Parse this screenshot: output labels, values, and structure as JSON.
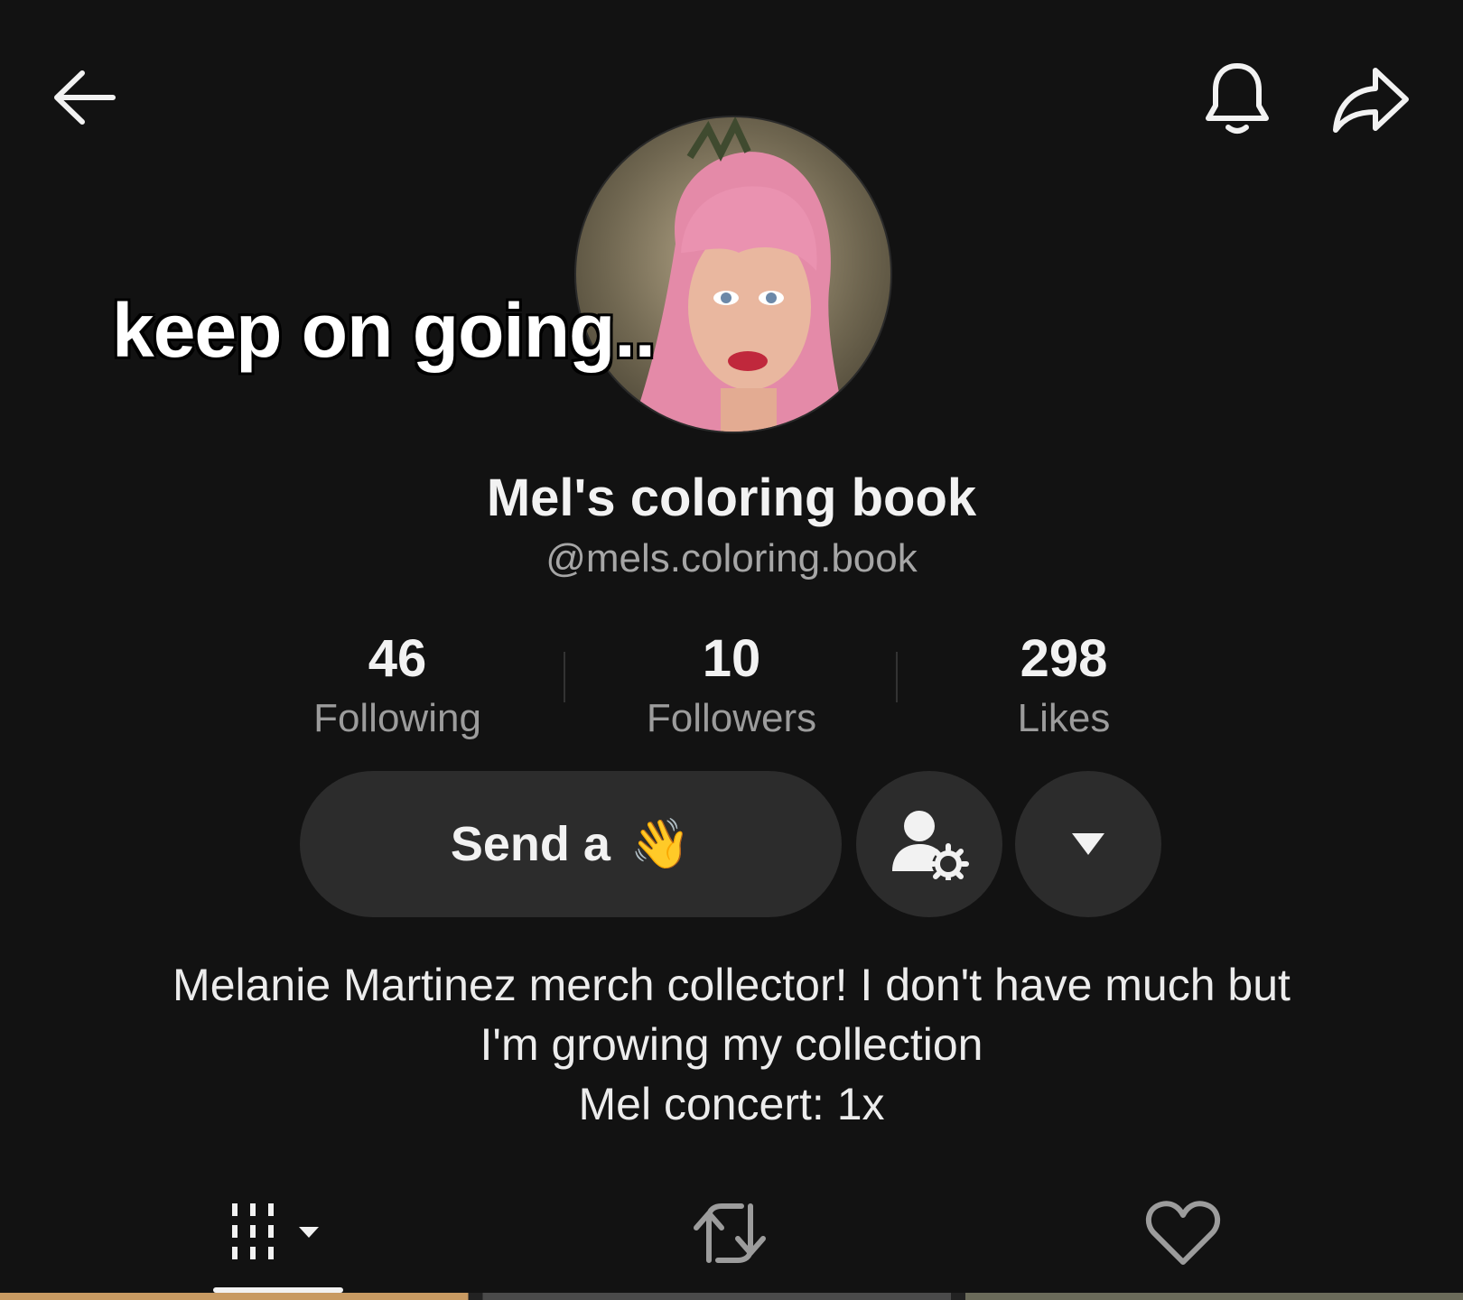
{
  "overlay_caption": "keep on going..",
  "profile": {
    "display_name": "Mel's coloring book",
    "username": "@mels.coloring.book"
  },
  "stats": {
    "following": {
      "value": "46",
      "label": "Following"
    },
    "followers": {
      "value": "10",
      "label": "Followers"
    },
    "likes": {
      "value": "298",
      "label": "Likes"
    }
  },
  "actions": {
    "wave_label": "Send a",
    "wave_emoji": "👋"
  },
  "bio": {
    "line1": "Melanie Martinez merch collector! I don't have much but",
    "line2": "I'm growing my collection",
    "line3": "Mel concert: 1x"
  },
  "tabs": [
    {
      "name": "videos",
      "icon": "grid-icon",
      "active": true
    },
    {
      "name": "reposts",
      "icon": "repost-icon",
      "active": false
    },
    {
      "name": "liked",
      "icon": "heart-icon",
      "active": false
    }
  ],
  "colors": {
    "background": "#121212",
    "button_bg": "#2c2c2c",
    "text_primary": "#f2f2f2",
    "text_secondary": "#9c9c9c"
  }
}
